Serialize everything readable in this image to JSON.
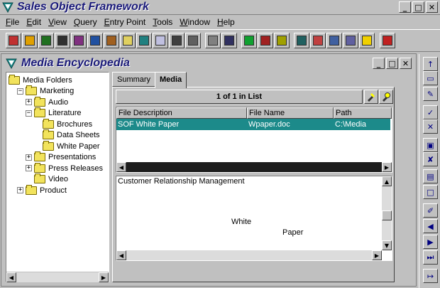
{
  "app": {
    "title": "Sales Object Framework",
    "minimize": "_",
    "restore": "□",
    "close": "✕"
  },
  "menu": [
    "File",
    "Edit",
    "View",
    "Query",
    "Entry Point",
    "Tools",
    "Window",
    "Help"
  ],
  "toolbar_icons": [
    "contacts-icon",
    "calendar-icon",
    "money-bag-icon",
    "runner-icon",
    "person-icon",
    "chart-icon",
    "suitcase-icon",
    "notepad-icon",
    "picture-icon",
    "notes-icon",
    "pen-icon",
    "mail-icon",
    "phone-icon",
    "projector-icon",
    "dollar-icon",
    "hierarchy-icon",
    "bar-chart-icon",
    "globe-icon",
    "form-icon",
    "list-icon",
    "calculator-icon",
    "lightning-icon",
    "exit-icon"
  ],
  "child": {
    "title": "Media Encyclopedia",
    "minimize": "_",
    "maximize": "□",
    "close": "✕"
  },
  "tree": [
    {
      "label": "Media Folders",
      "level": 0,
      "expander": ""
    },
    {
      "label": "Marketing",
      "level": 1,
      "expander": "−"
    },
    {
      "label": "Audio",
      "level": 2,
      "expander": "+"
    },
    {
      "label": "Literature",
      "level": 2,
      "expander": "−"
    },
    {
      "label": "Brochures",
      "level": 3,
      "expander": ""
    },
    {
      "label": "Data Sheets",
      "level": 3,
      "expander": ""
    },
    {
      "label": "White Paper",
      "level": 3,
      "expander": ""
    },
    {
      "label": "Presentations",
      "level": 2,
      "expander": "+"
    },
    {
      "label": "Press Releases",
      "level": 2,
      "expander": "+"
    },
    {
      "label": "Video",
      "level": 2,
      "expander": ""
    },
    {
      "label": "Product",
      "level": 1,
      "expander": "+"
    }
  ],
  "tabs": [
    {
      "label": "Summary",
      "active": false
    },
    {
      "label": "Media",
      "active": true
    }
  ],
  "list": {
    "count": "1 of 1 in List",
    "columns": [
      "File Description",
      "File Name",
      "Path"
    ],
    "rows": [
      {
        "description": "SOF White Paper",
        "file": "Wpaper.doc",
        "path": "C:\\Media"
      }
    ]
  },
  "memo": {
    "heading": "Customer Relationship Management",
    "word1": "White",
    "word2": "Paper"
  },
  "vtoolbar_icons": [
    "arrow-up-icon",
    "folder-open-icon",
    "pen-icon",
    "check-icon",
    "delete-icon",
    "copy-icon",
    "cancel-icon",
    "paste-icon",
    "page-icon",
    "paperclip-icon",
    "prev-icon",
    "next-icon",
    "last-icon",
    "exit-door-icon"
  ],
  "colors": {
    "selection": "#1c8a8a",
    "title_text": "#1a1a7a",
    "folder": "#f2e35c"
  }
}
